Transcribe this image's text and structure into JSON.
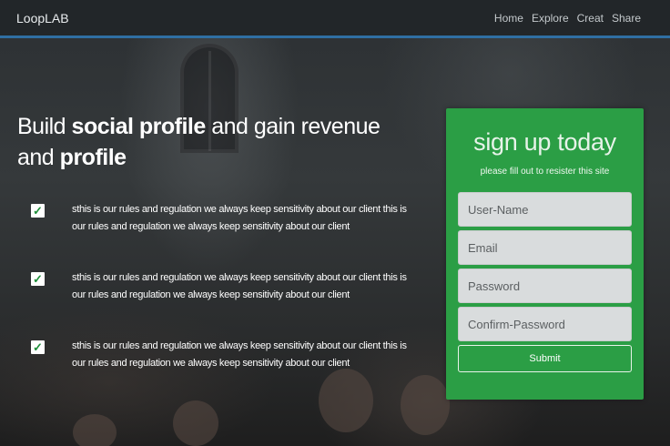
{
  "navbar": {
    "brand": "LoopLAB",
    "links": [
      "Home",
      "Explore",
      "Creat",
      "Share"
    ]
  },
  "hero": {
    "title_parts": [
      "Build ",
      "social profile",
      " and gain revenue and ",
      "profile"
    ]
  },
  "features": [
    {
      "icon": "check-icon",
      "text": "sthis is our rules and regulation we always keep sensitivity about our client this is our rules and regulation we always keep sensitivity about our client"
    },
    {
      "icon": "check-icon",
      "text": "sthis is our rules and regulation we always keep sensitivity about our client this is our rules and regulation we always keep sensitivity about our client"
    },
    {
      "icon": "check-icon",
      "text": "sthis is our rules and regulation we always keep sensitivity about our client this is our rules and regulation we always keep sensitivity about our client"
    }
  ],
  "signup": {
    "title": "sign up today",
    "subtitle": "please fill out to resister this site",
    "fields": [
      {
        "placeholder": "User-Name",
        "value": ""
      },
      {
        "placeholder": "Email",
        "value": ""
      },
      {
        "placeholder": "Password",
        "value": ""
      },
      {
        "placeholder": "Confirm-Password",
        "value": ""
      }
    ],
    "submit_label": "Submit"
  },
  "colors": {
    "navbar": "#222629",
    "navbar_accent": "#2f6fa3",
    "card": "#2b9e45",
    "check": "#1f8f3a"
  }
}
